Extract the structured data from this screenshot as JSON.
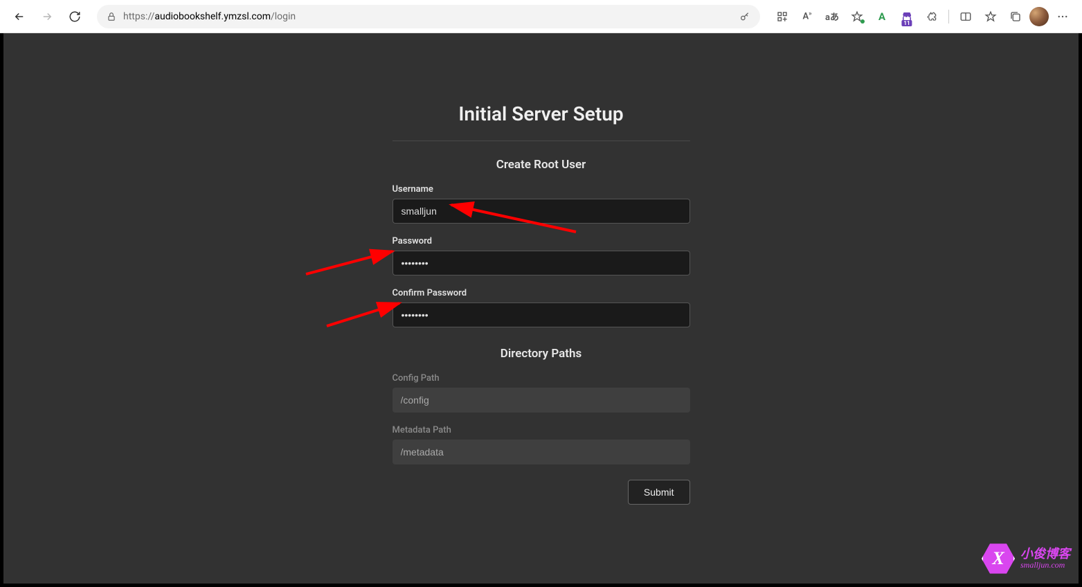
{
  "browser": {
    "url_prefix": "https://",
    "url_domain": "audiobookshelf.ymzsl.com",
    "url_path": "/login"
  },
  "page": {
    "title": "Initial Server Setup",
    "user_section": {
      "heading": "Create Root User",
      "username_label": "Username",
      "username_value": "smalljun",
      "password_label": "Password",
      "password_value": "••••••••",
      "confirm_label": "Confirm Password",
      "confirm_value": "••••••••"
    },
    "paths_section": {
      "heading": "Directory Paths",
      "config_label": "Config Path",
      "config_value": "/config",
      "metadata_label": "Metadata Path",
      "metadata_value": "/metadata"
    },
    "submit_label": "Submit"
  },
  "watermark": {
    "line1": "小俊博客",
    "line2": "smalljun.com",
    "badge_letter": "X"
  },
  "shop_badge": "11"
}
